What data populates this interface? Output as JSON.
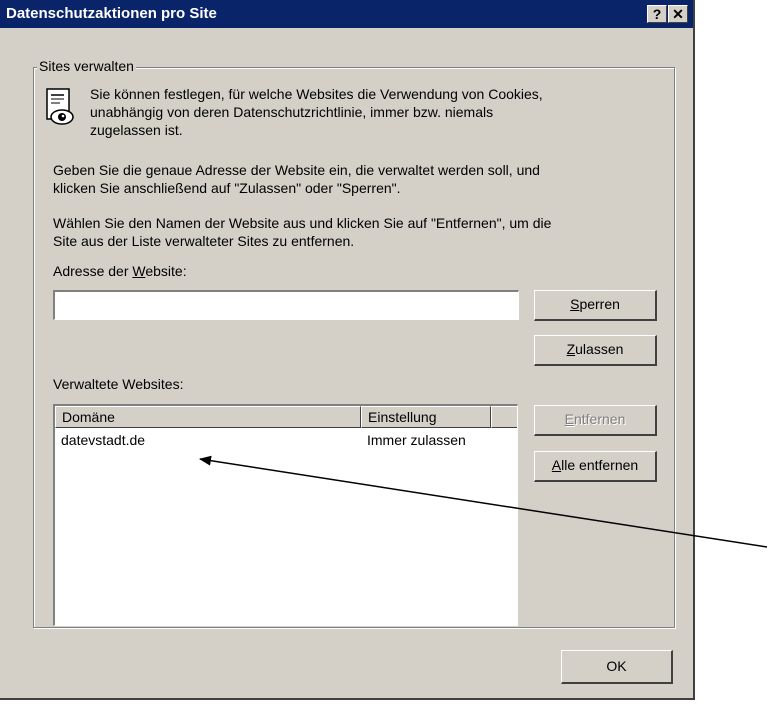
{
  "window": {
    "title": "Datenschutzaktionen pro Site",
    "help_label": "?",
    "close_label": "✕"
  },
  "group": {
    "legend": "Sites verwalten",
    "intro_line1": "Sie können festlegen, für welche Websites die Verwendung von Cookies,",
    "intro_line2": "unabhängig von deren Datenschutzrichtlinie, immer bzw. niemals",
    "intro_line3": "zugelassen ist.",
    "para1_line1": "Geben Sie die genaue Adresse der Website ein, die verwaltet werden soll, und",
    "para1_line2": "klicken Sie anschließend auf \"Zulassen\" oder \"Sperren\".",
    "para2_line1": "Wählen Sie den Namen der Website aus und klicken Sie auf \"Entfernen\", um die",
    "para2_line2": "Site aus der Liste verwalteter Sites zu entfernen."
  },
  "address": {
    "label_pre": "Adresse der ",
    "label_key": "W",
    "label_post": "ebsite:",
    "value": ""
  },
  "buttons": {
    "block_key": "S",
    "block_rest": "perren",
    "allow_key": "Z",
    "allow_rest": "ulassen",
    "remove_key": "E",
    "remove_rest": "ntfernen",
    "remove_all_key": "A",
    "remove_all_rest": "lle entfernen",
    "ok": "OK"
  },
  "managed": {
    "label": "Verwaltete Websites:",
    "columns": [
      "Domäne",
      "Einstellung"
    ],
    "rows": [
      {
        "domain": "datevstadt.de",
        "setting": "Immer zulassen"
      }
    ]
  },
  "icons": {
    "document": "document-privacy-icon",
    "arrow": "annotation-arrow"
  },
  "colors": {
    "titlebar": "#0a246a",
    "dialog": "#d4d0c8"
  }
}
